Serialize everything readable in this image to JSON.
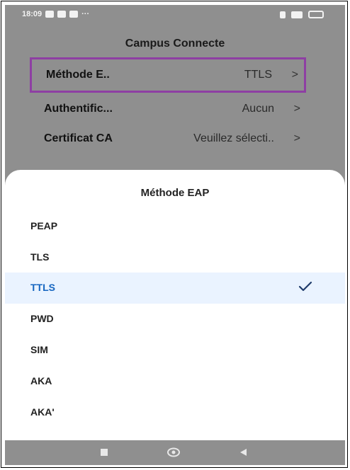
{
  "status_bar": {
    "time": "18:09"
  },
  "header": {
    "title": "Campus Connecte"
  },
  "settings_rows": [
    {
      "label": "Méthode E..",
      "value": "TTLS"
    },
    {
      "label": "Authentific...",
      "value": "Aucun"
    },
    {
      "label": "Certificat CA",
      "value": "Veuillez sélecti.."
    }
  ],
  "sheet": {
    "title": "Méthode EAP",
    "options": [
      "PEAP",
      "TLS",
      "TTLS",
      "PWD",
      "SIM",
      "AKA",
      "AKA'"
    ],
    "selected": "TTLS"
  },
  "colors": {
    "highlight_border": "#8e3fa3",
    "selected_text": "#1565c0",
    "selected_bg": "#eaf3ff"
  }
}
